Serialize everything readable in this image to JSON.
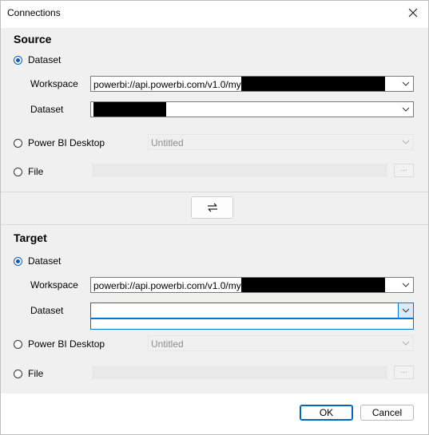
{
  "window": {
    "title": "Connections"
  },
  "source": {
    "title": "Source",
    "options": {
      "dataset": "Dataset",
      "desktop": "Power BI Desktop",
      "file": "File"
    },
    "selected": "dataset",
    "workspace_label": "Workspace",
    "workspace_value": "powerbi://api.powerbi.com/v1.0/myorg",
    "dataset_label": "Dataset",
    "dataset_value": "",
    "desktop_value": "Untitled",
    "file_value": "",
    "browse_label": "..."
  },
  "target": {
    "title": "Target",
    "options": {
      "dataset": "Dataset",
      "desktop": "Power BI Desktop",
      "file": "File"
    },
    "selected": "dataset",
    "workspace_label": "Workspace",
    "workspace_value": "powerbi://api.powerbi.com/v1.0/myorg",
    "dataset_label": "Dataset",
    "dataset_value": "",
    "desktop_value": "Untitled",
    "file_value": "",
    "browse_label": "..."
  },
  "icons": {
    "close": "close-icon",
    "swap": "swap-arrows-icon",
    "chevron": "chevron-down-icon"
  },
  "colors": {
    "accent": "#0078d7",
    "radio_selected": "#0a5fb4",
    "panel_background": "#f0f0f0"
  },
  "footer": {
    "ok_label": "OK",
    "cancel_label": "Cancel"
  }
}
